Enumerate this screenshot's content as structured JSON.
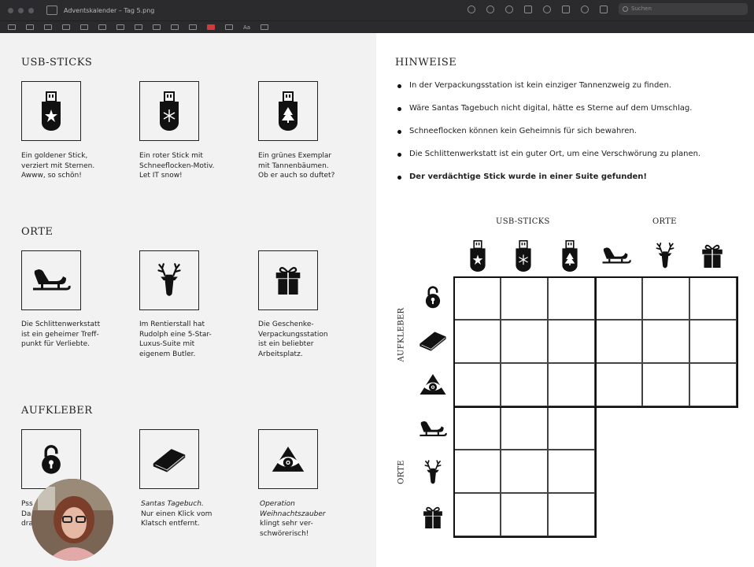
{
  "window": {
    "title": "Adventskalender – Tag 5.png",
    "search_placeholder": "Suchen",
    "text_tool_label": "Aa"
  },
  "left": {
    "sections": [
      {
        "heading": "USB-STICKS",
        "items": [
          {
            "icon": "usb-star-icon",
            "caption": [
              "Ein goldener Stick,",
              "verziert mit Sternen.",
              "Awww, so schön!"
            ]
          },
          {
            "icon": "usb-snowflake-icon",
            "caption": [
              "Ein roter Stick mit",
              "Schneeflocken-Motiv.",
              "Let IT snow!"
            ]
          },
          {
            "icon": "usb-tree-icon",
            "caption": [
              "Ein grünes Exemplar",
              "mit Tannenbäumen.",
              "Ob er auch so duftet?"
            ]
          }
        ]
      },
      {
        "heading": "ORTE",
        "items": [
          {
            "icon": "sleigh-icon",
            "caption": [
              "Die Schlittenwerkstatt",
              "ist ein geheimer Treff-",
              "punkt für Verliebte."
            ]
          },
          {
            "icon": "reindeer-icon",
            "caption": [
              "Im Rentierstall hat",
              "Rudolph eine 5-Star-",
              "Luxus-Suite mit",
              "eigenem Butler."
            ]
          },
          {
            "icon": "gift-icon",
            "caption": [
              "Die Geschenke-",
              "Verpackungsstation",
              "ist ein beliebter",
              "Arbeitsplatz."
            ]
          }
        ]
      },
      {
        "heading": "AUFKLEBER",
        "items": [
          {
            "icon": "padlock-icon",
            "caption": [
              "Pss",
              "Da",
              "dra"
            ]
          },
          {
            "icon": "book-icon",
            "caption": [
              "Santas Tagebuch.",
              "Nur einen Klick vom",
              "Klatsch entfernt."
            ]
          },
          {
            "icon": "eye-pyramid-icon",
            "caption": [
              "Operation",
              "Weihnachtszauber",
              "klingt sehr ver-",
              "schwörerisch!"
            ]
          }
        ]
      }
    ]
  },
  "right": {
    "heading": "HINWEISE",
    "hints": [
      "In der Verpackungsstation ist kein einziger Tannenzweig zu finden.",
      "Wäre Santas Tagebuch nicht digital, hätte es Sterne auf dem Umschlag.",
      "Schneeflocken können kein Geheimnis für sich bewahren.",
      "Die Schlittenwerkstatt ist ein guter Ort, um eine Verschwörung zu planen.",
      "Der verdächtige Stick wurde in einer Suite gefunden!"
    ],
    "grid": {
      "col_group_1": "USB-STICKS",
      "col_group_2": "ORTE",
      "row_group_1": "AUFKLEBER",
      "row_group_2": "ORTE",
      "col_icons": [
        "usb-star-icon",
        "usb-snowflake-icon",
        "usb-tree-icon",
        "sleigh-icon",
        "reindeer-icon",
        "gift-icon"
      ],
      "row_icons": [
        "padlock-icon",
        "book-icon",
        "eye-pyramid-icon",
        "sleigh-icon",
        "reindeer-icon",
        "gift-icon"
      ]
    }
  }
}
